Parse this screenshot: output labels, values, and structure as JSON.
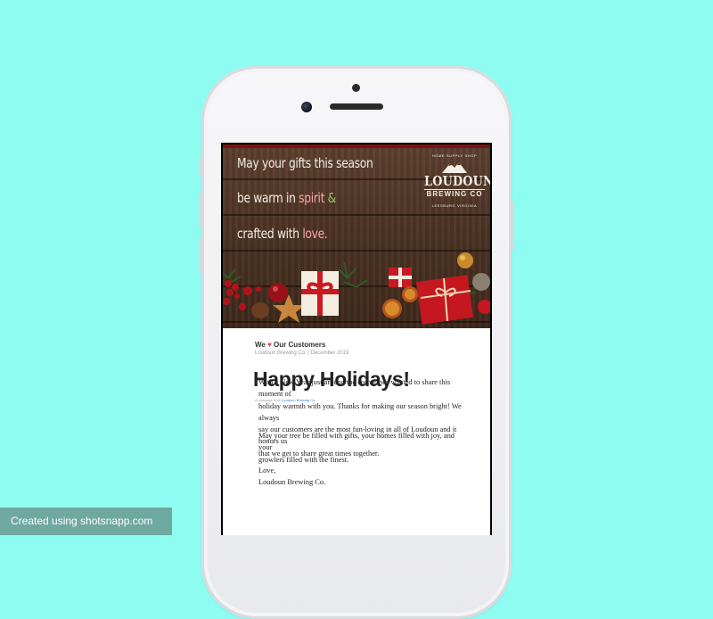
{
  "banner": {
    "line1": "May your gifts this season",
    "line2_prefix": "be warm in ",
    "line2_highlight": "spirit",
    "line2_amp": " &",
    "line3_prefix": "crafted with ",
    "line3_highlight": "love.",
    "logo": {
      "name": "LOUDOUN",
      "subtitle": "BREWING CO",
      "top_text": "HOME SUPPLY SHOP",
      "bottom_text": "LEESBURG VIRGINIA"
    }
  },
  "email": {
    "preheader_before": "We ",
    "preheader_heart": "♥",
    "preheader_after": " Our Customers",
    "subheader": "Loudoun Brewing Co. | December 2019",
    "title": "Happy Holidays!",
    "byline_prefix": "A message from ",
    "byline_link": "Loudoun Brewing Co",
    "paragraph1": [
      "With a New Year just around the corner, we wanted to share this moment of",
      "holiday warmth with you. Thanks for making our season bright! We always",
      "say our customers are the most fun-loving in all of Loudoun and it honors us",
      "that we get to share great times together."
    ],
    "paragraph2": [
      "May your tree be filled with gifts, your homes filled with joy, and your",
      "growlers filled with the finest."
    ],
    "signoff": "Love,",
    "signature": "Loudoun Brewing Co."
  },
  "watermark": {
    "text": "Created using shotsnapp.com"
  },
  "colors": {
    "background": "#8ffcf1",
    "accent_pink": "#f5a8a8",
    "heart": "#d8453b",
    "link": "#3b7bd0",
    "badge": "#6fa89f"
  }
}
